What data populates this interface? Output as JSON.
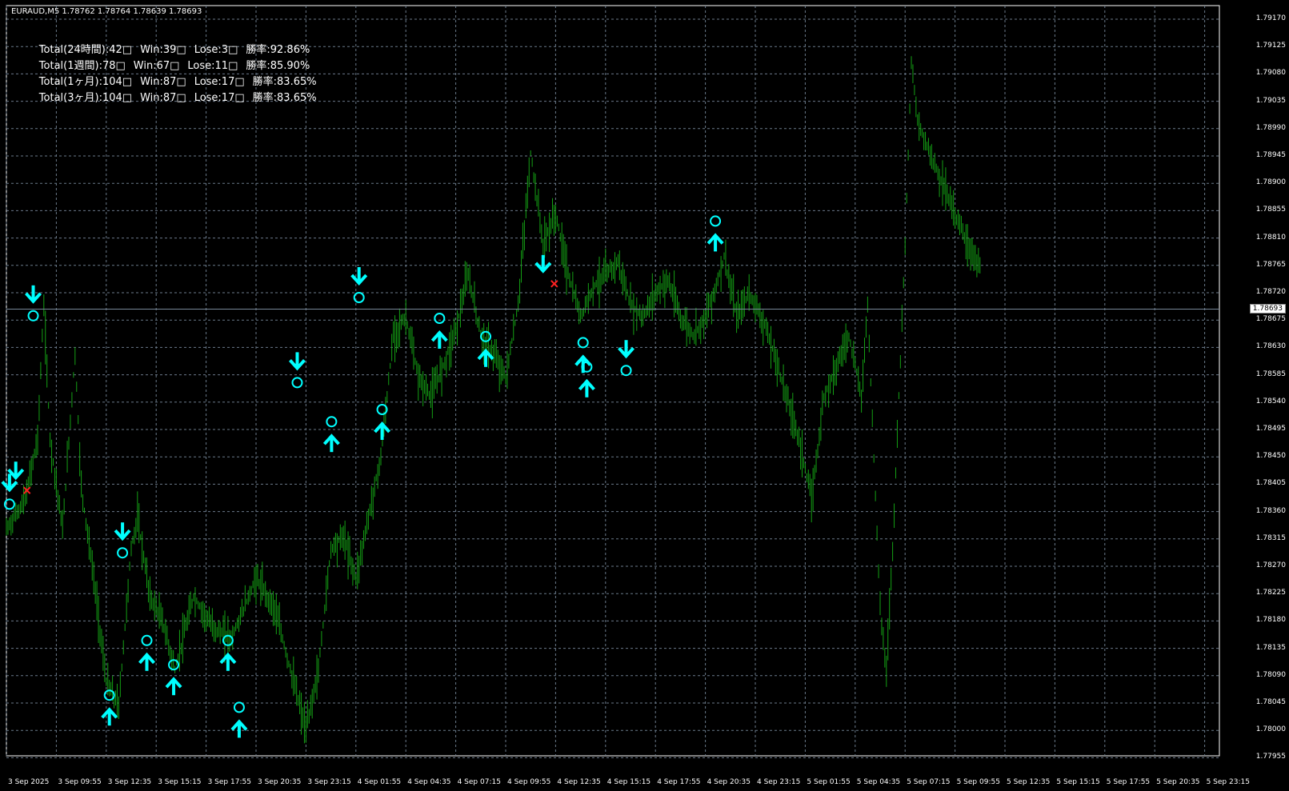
{
  "window": {
    "title": "EURAUD,M5  1.78762 1.78764 1.78639 1.78693"
  },
  "stats": [
    {
      "total": "Total(24時間):42□",
      "win": "Win:39□",
      "lose": "Lose:3□",
      "rate": "勝率:92.86%"
    },
    {
      "total": "Total(1週間):78□",
      "win": "Win:67□",
      "lose": "Lose:11□",
      "rate": "勝率:85.90%"
    },
    {
      "total": "Total(1ヶ月):104□",
      "win": "Win:87□",
      "lose": "Lose:17□",
      "rate": "勝率:83.65%"
    },
    {
      "total": "Total(3ヶ月):104□",
      "win": "Win:87□",
      "lose": "Lose:17□",
      "rate": "勝率:83.65%"
    }
  ],
  "price_axis": {
    "labels": [
      "1.79170",
      "1.79125",
      "1.79080",
      "1.79035",
      "1.78990",
      "1.78945",
      "1.78900",
      "1.78855",
      "1.78810",
      "1.78765",
      "1.78720",
      "1.78675",
      "1.78630",
      "1.78585",
      "1.78540",
      "1.78495",
      "1.78450",
      "1.78405",
      "1.78360",
      "1.78315",
      "1.78270",
      "1.78225",
      "1.78180",
      "1.78135",
      "1.78090",
      "1.78045",
      "1.78000",
      "1.77955"
    ],
    "current_price": "1.78693"
  },
  "time_axis": {
    "labels": [
      "3 Sep 2025",
      "3 Sep 09:55",
      "3 Sep 12:35",
      "3 Sep 15:15",
      "3 Sep 17:55",
      "3 Sep 20:35",
      "3 Sep 23:15",
      "4 Sep 01:55",
      "4 Sep 04:35",
      "4 Sep 07:15",
      "4 Sep 09:55",
      "4 Sep 12:35",
      "4 Sep 15:15",
      "4 Sep 17:55",
      "4 Sep 20:35",
      "4 Sep 23:15",
      "5 Sep 01:55",
      "5 Sep 04:35",
      "5 Sep 07:15",
      "5 Sep 09:55",
      "5 Sep 12:35",
      "5 Sep 15:15",
      "5 Sep 17:55",
      "5 Sep 20:35",
      "5 Sep 23:15"
    ]
  },
  "colors": {
    "background": "#000000",
    "grid": "#6b7a8a",
    "bars": "#14a014",
    "signal": "#00ffff",
    "loss_mark": "#ff2020",
    "current_line": "#778899"
  },
  "chart_data": {
    "type": "line",
    "symbol": "EURAUD",
    "timeframe": "M5",
    "x": [
      "3 Sep 2025",
      "3 Sep 09:55",
      "3 Sep 12:35",
      "3 Sep 15:15",
      "3 Sep 17:55",
      "3 Sep 20:35",
      "3 Sep 23:15",
      "4 Sep 01:55",
      "4 Sep 04:35",
      "4 Sep 07:15",
      "4 Sep 09:55",
      "4 Sep 12:35",
      "4 Sep 15:15",
      "4 Sep 17:55",
      "4 Sep 20:35",
      "4 Sep 23:15",
      "5 Sep 01:55",
      "5 Sep 04:35",
      "5 Sep 07:15",
      "5 Sep 09:55",
      "5 Sep 12:35",
      "5 Sep 15:15",
      "5 Sep 17:55",
      "5 Sep 20:35",
      "5 Sep 23:15"
    ],
    "price_path": [
      [
        0,
        1.7833
      ],
      [
        3,
        1.7838
      ],
      [
        5,
        1.7848
      ],
      [
        6,
        1.787
      ],
      [
        7,
        1.7848
      ],
      [
        9,
        1.7833
      ],
      [
        11,
        1.7862
      ],
      [
        12,
        1.784
      ],
      [
        14,
        1.7825
      ],
      [
        16,
        1.7808
      ],
      [
        18,
        1.7804
      ],
      [
        20,
        1.783
      ],
      [
        21,
        1.7835
      ],
      [
        23,
        1.7822
      ],
      [
        25,
        1.7818
      ],
      [
        27,
        1.781
      ],
      [
        30,
        1.7822
      ],
      [
        33,
        1.7817
      ],
      [
        36,
        1.7815
      ],
      [
        40,
        1.7825
      ],
      [
        43,
        1.782
      ],
      [
        46,
        1.7808
      ],
      [
        48,
        1.78
      ],
      [
        50,
        1.781
      ],
      [
        52,
        1.783
      ],
      [
        54,
        1.7832
      ],
      [
        56,
        1.7825
      ],
      [
        58,
        1.7835
      ],
      [
        60,
        1.7845
      ],
      [
        62,
        1.7865
      ],
      [
        64,
        1.7868
      ],
      [
        66,
        1.7858
      ],
      [
        68,
        1.7855
      ],
      [
        70,
        1.786
      ],
      [
        72,
        1.7866
      ],
      [
        74,
        1.7875
      ],
      [
        76,
        1.7865
      ],
      [
        78,
        1.7862
      ],
      [
        80,
        1.7858
      ],
      [
        82,
        1.787
      ],
      [
        84,
        1.7895
      ],
      [
        86,
        1.788
      ],
      [
        88,
        1.7885
      ],
      [
        90,
        1.7875
      ],
      [
        92,
        1.7868
      ],
      [
        94,
        1.7873
      ],
      [
        96,
        1.7875
      ],
      [
        98,
        1.7877
      ],
      [
        100,
        1.787
      ],
      [
        102,
        1.7868
      ],
      [
        104,
        1.7872
      ],
      [
        106,
        1.7874
      ],
      [
        108,
        1.7868
      ],
      [
        110,
        1.7865
      ],
      [
        112,
        1.7868
      ],
      [
        114,
        1.7874
      ],
      [
        115,
        1.7878
      ],
      [
        117,
        1.7868
      ],
      [
        119,
        1.7872
      ],
      [
        121,
        1.7868
      ],
      [
        123,
        1.7862
      ],
      [
        125,
        1.7855
      ],
      [
        127,
        1.7848
      ],
      [
        129,
        1.7838
      ],
      [
        131,
        1.7855
      ],
      [
        133,
        1.786
      ],
      [
        135,
        1.7865
      ],
      [
        137,
        1.7855
      ],
      [
        138,
        1.787
      ],
      [
        139,
        1.7845
      ],
      [
        140,
        1.782
      ],
      [
        141,
        1.781
      ],
      [
        142,
        1.783
      ],
      [
        144,
        1.788
      ],
      [
        145,
        1.791
      ],
      [
        146,
        1.79
      ],
      [
        148,
        1.7895
      ],
      [
        150,
        1.789
      ],
      [
        152,
        1.7885
      ],
      [
        154,
        1.788
      ],
      [
        156,
        1.7876
      ]
    ],
    "signals": [
      {
        "t": 0.5,
        "dir": "down",
        "price": 1.7838,
        "result": "win"
      },
      {
        "t": 1.5,
        "dir": "down",
        "price": 1.784,
        "result": "loss"
      },
      {
        "t": 4.3,
        "dir": "down",
        "price": 1.7869,
        "result": "win"
      },
      {
        "t": 16.5,
        "dir": "up",
        "price": 1.7805,
        "result": "win"
      },
      {
        "t": 18.6,
        "dir": "down",
        "price": 1.783,
        "result": "win"
      },
      {
        "t": 22.5,
        "dir": "up",
        "price": 1.7814,
        "result": "win"
      },
      {
        "t": 26.8,
        "dir": "up",
        "price": 1.781,
        "result": "win"
      },
      {
        "t": 35.5,
        "dir": "up",
        "price": 1.7814,
        "result": "win"
      },
      {
        "t": 37.3,
        "dir": "up",
        "price": 1.7803,
        "result": "win"
      },
      {
        "t": 46.6,
        "dir": "down",
        "price": 1.7858,
        "result": "win"
      },
      {
        "t": 52.1,
        "dir": "up",
        "price": 1.785,
        "result": "win"
      },
      {
        "t": 56.5,
        "dir": "down",
        "price": 1.7872,
        "result": "win"
      },
      {
        "t": 60.2,
        "dir": "up",
        "price": 1.7852,
        "result": "win"
      },
      {
        "t": 69.4,
        "dir": "up",
        "price": 1.7867,
        "result": "win"
      },
      {
        "t": 76.8,
        "dir": "up",
        "price": 1.7864,
        "result": "win"
      },
      {
        "t": 86.0,
        "dir": "down",
        "price": 1.7874,
        "result": "loss"
      },
      {
        "t": 92.4,
        "dir": "up",
        "price": 1.7863,
        "result": "win"
      },
      {
        "t": 93.0,
        "dir": "up",
        "price": 1.7859,
        "result": "win"
      },
      {
        "t": 99.3,
        "dir": "down",
        "price": 1.786,
        "result": "win"
      },
      {
        "t": 113.6,
        "dir": "up",
        "price": 1.7883,
        "result": "win"
      }
    ]
  }
}
